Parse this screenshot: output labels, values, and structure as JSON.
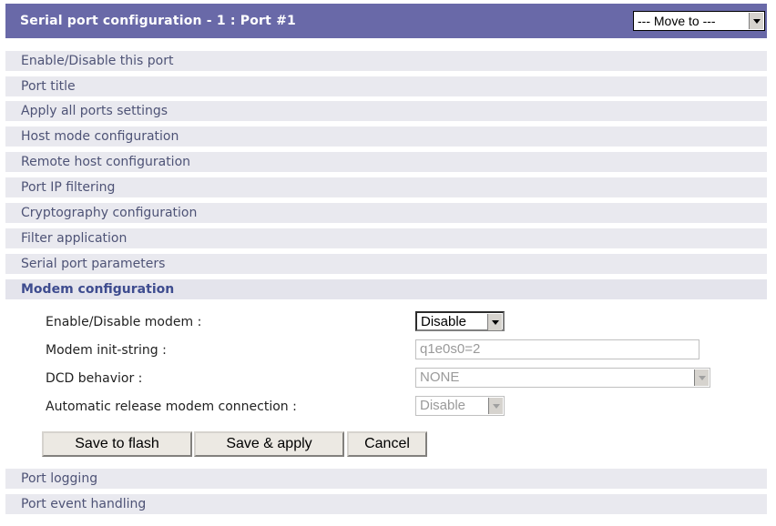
{
  "header": {
    "title": "Serial port configuration - 1 : Port #1",
    "move_to": "--- Move to ---"
  },
  "sections_top": [
    "Enable/Disable this port",
    "Port title",
    "Apply all ports settings",
    "Host mode configuration",
    "Remote host configuration",
    "Port IP filtering",
    "Cryptography configuration",
    "Filter application",
    "Serial port parameters"
  ],
  "active_section": "Modem configuration",
  "modem": {
    "enable_label": "Enable/Disable modem :",
    "enable_value": "Disable",
    "init_label": "Modem init-string :",
    "init_value": "q1e0s0=2",
    "dcd_label": "DCD behavior :",
    "dcd_value": "NONE",
    "auto_label": "Automatic release modem connection :",
    "auto_value": "Disable"
  },
  "buttons": {
    "save_flash": "Save to flash",
    "save_apply": "Save & apply",
    "cancel": "Cancel"
  },
  "sections_bottom": [
    "Port logging",
    "Port event handling"
  ]
}
